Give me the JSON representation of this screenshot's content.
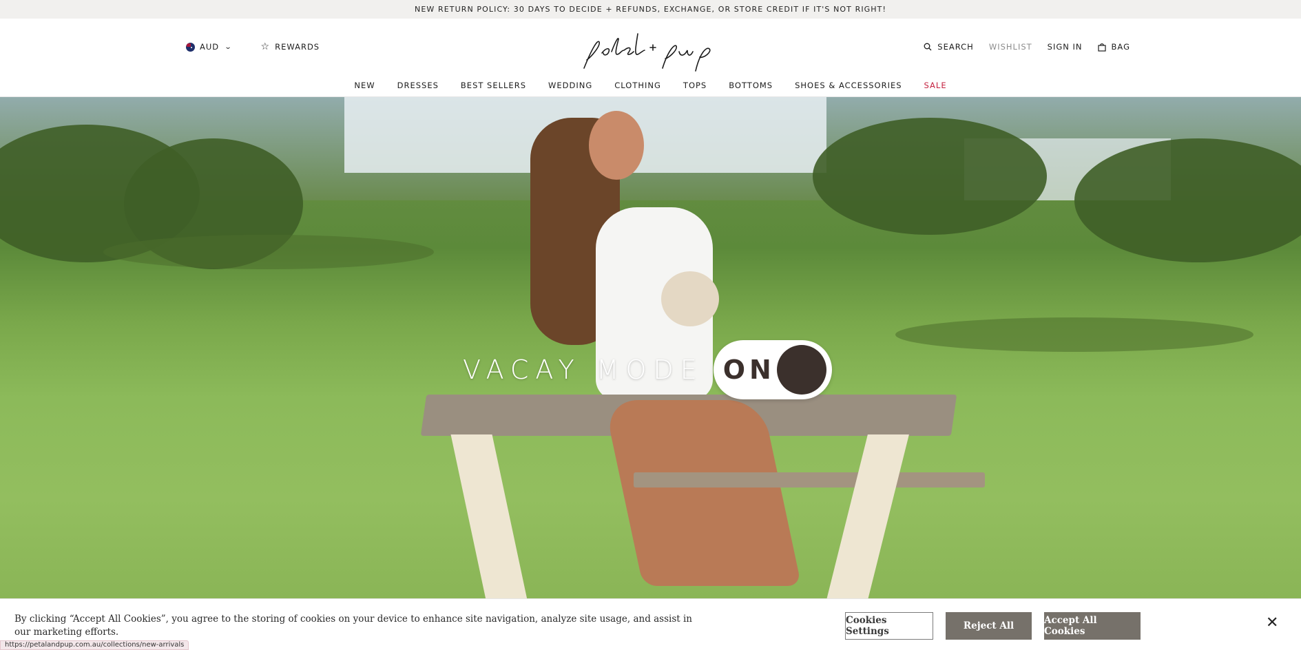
{
  "announcement": "NEW RETURN POLICY: 30 DAYS TO DECIDE + REFUNDS, EXCHANGE, OR STORE CREDIT IF IT'S NOT RIGHT!",
  "header": {
    "currency": "AUD",
    "rewards": "REWARDS",
    "logo_text": "petal + pup",
    "search": "SEARCH",
    "wishlist": "WISHLIST",
    "sign_in": "SIGN IN",
    "bag": "BAG"
  },
  "nav": [
    "NEW",
    "DRESSES",
    "BEST SELLERS",
    "WEDDING",
    "CLOTHING",
    "TOPS",
    "BOTTOMS",
    "SHOES & ACCESSORIES",
    "SALE"
  ],
  "hero": {
    "headline": "VACAY MODE",
    "toggle_label": "ON"
  },
  "cookie": {
    "text": "By clicking “Accept All Cookies”, you agree to the storing of cookies on your device to enhance site navigation, analyze site usage, and assist in our marketing efforts.",
    "settings": "Cookies Settings",
    "reject": "Reject All",
    "accept": "Accept All Cookies",
    "close": "✕"
  },
  "status_url": "https://petalandpup.com.au/collections/new-arrivals",
  "colors": {
    "sale": "#c4213f",
    "toggle_knob": "#3b302c",
    "cookie_button": "#76716a"
  }
}
